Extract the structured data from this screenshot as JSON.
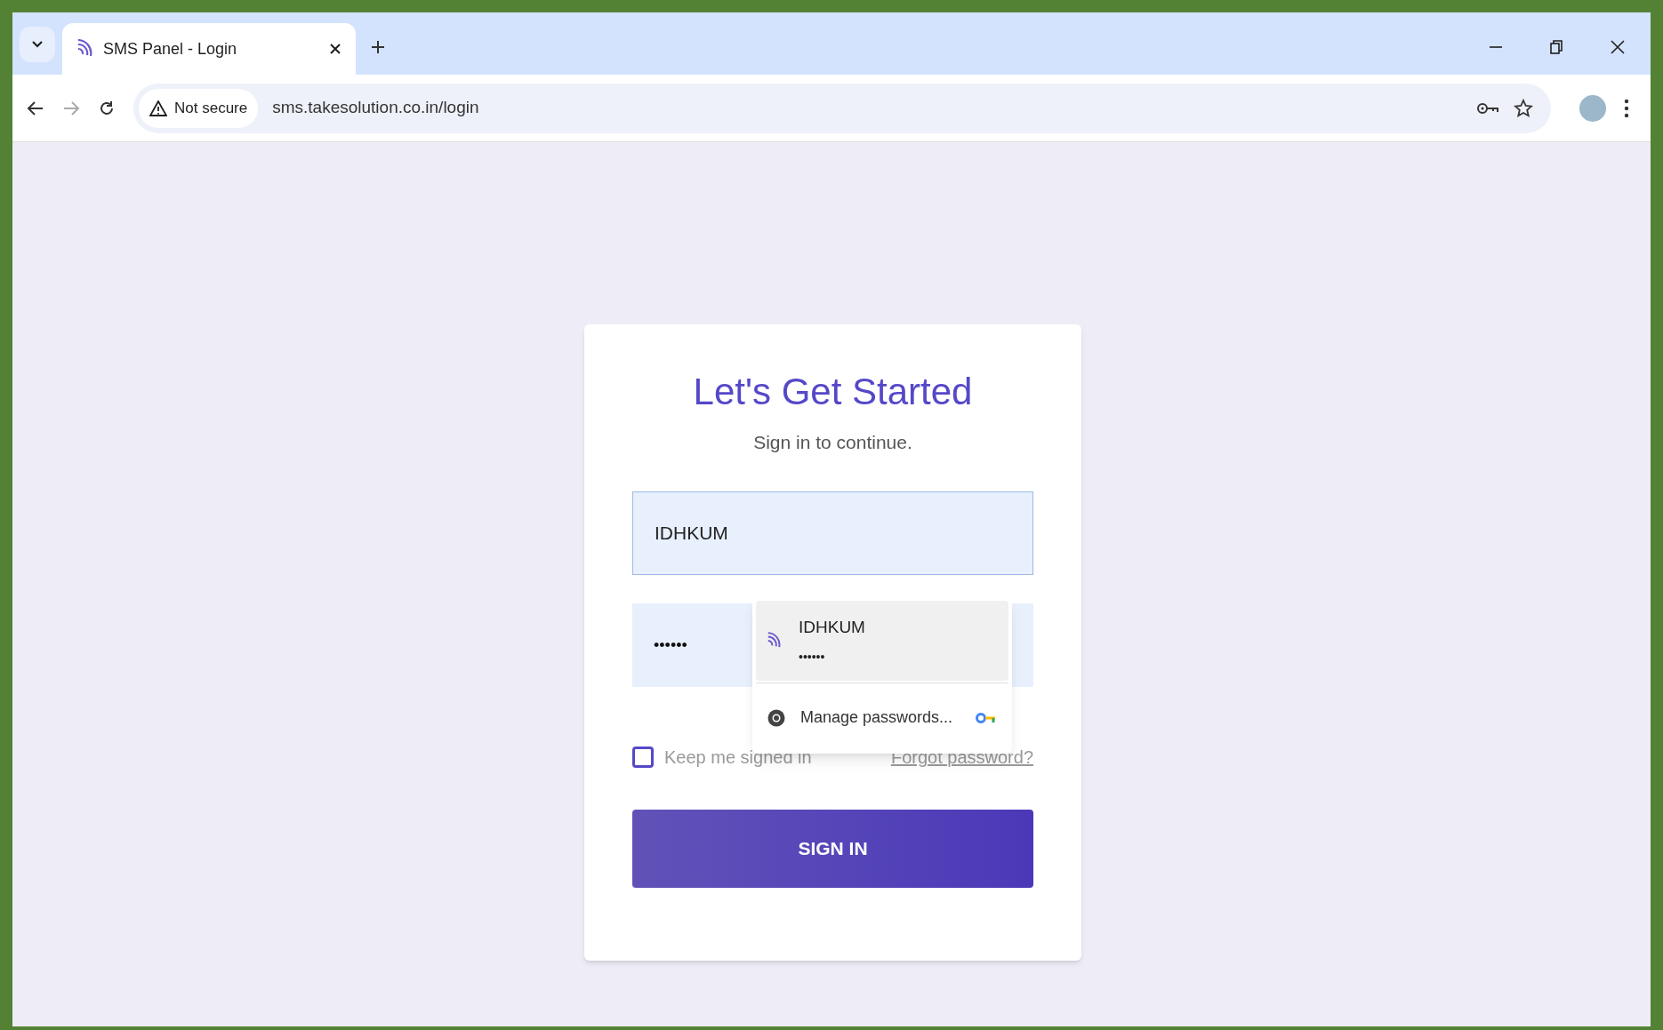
{
  "browser": {
    "tab": {
      "title": "SMS Panel - Login",
      "selected": true
    },
    "security_chip": "Not secure",
    "url": "sms.takesolution.co.in/login"
  },
  "login": {
    "title": "Let's Get Started",
    "subtitle": "Sign in to continue.",
    "username": {
      "value": "IDHKUM"
    },
    "password": {
      "value": "••••••"
    },
    "keep_signed_in": {
      "label": "Keep me signed in",
      "checked": false
    },
    "forgot_link": "Forgot password?",
    "submit": "SIGN IN"
  },
  "password_popup": {
    "suggestions": [
      {
        "username": "IDHKUM",
        "password": "••••••",
        "selected": true
      }
    ],
    "manage": "Manage passwords..."
  }
}
